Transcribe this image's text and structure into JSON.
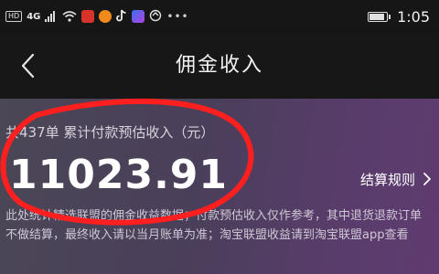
{
  "status_bar": {
    "left_indicators": [
      "HD",
      "4G"
    ],
    "time": "1:05",
    "battery_level": 0.8,
    "app_icons": [
      "notification-app-icon-red",
      "taobao-icon",
      "tiktok-icon",
      "video-app-icon",
      "vpn-icon",
      "more-dots-icon"
    ],
    "colors": {
      "red": "#e03a2f",
      "orange": "#f08a1c",
      "purple": "#a04ddc",
      "highlight": "#ff2020"
    }
  },
  "nav": {
    "title": "佣金收入",
    "back_icon": "chevron-left-icon"
  },
  "summary": {
    "text": "共437单 累计付款预估收入（元）",
    "amount": "11023.91",
    "rules_label": "结算规则",
    "rules_icon": "chevron-right-icon",
    "note": "此处统计精选联盟的佣金收益数据；付款预估收入仅作参考，其中退货退款订单不做结算，最终收入请以当月账单为准；淘宝联盟收益请到淘宝联盟app查看"
  }
}
